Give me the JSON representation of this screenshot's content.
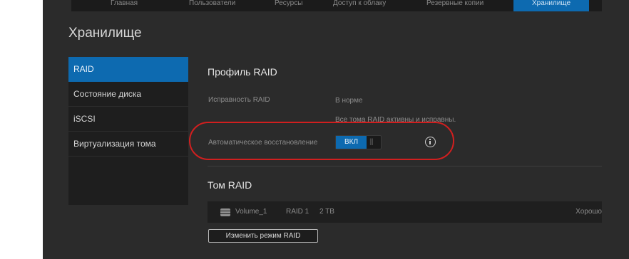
{
  "nav": {
    "tabs": [
      {
        "label": "Главная"
      },
      {
        "label": "Пользователи"
      },
      {
        "label": "Ресурсы"
      },
      {
        "label": "Доступ к облаку"
      },
      {
        "label": "Резервные копии"
      },
      {
        "label": "Хранилище"
      }
    ],
    "active_color": "#0d6ab0"
  },
  "page_title": "Хранилище",
  "sidebar": {
    "items": [
      {
        "label": "RAID",
        "active": true
      },
      {
        "label": "Состояние диска"
      },
      {
        "label": "iSCSI"
      },
      {
        "label": "Виртуализация тома"
      }
    ]
  },
  "raid_profile": {
    "title": "Профиль RAID",
    "health_label": "Исправность RAID",
    "health_value": "В норме",
    "health_detail": "Все тома RAID активны и исправны.",
    "auto_rebuild_label": "Автоматическое восстановление",
    "toggle_on_label": "ВКЛ",
    "toggle_state": "on",
    "info_icon": "info-icon"
  },
  "raid_volume": {
    "title": "Том RAID",
    "rows": [
      {
        "name": "Volume_1",
        "mode": "RAID 1",
        "size": "2 TB",
        "status": "Хорошо"
      }
    ],
    "change_button": "Изменить режим RAID"
  },
  "highlight_color": "#d11f1f"
}
